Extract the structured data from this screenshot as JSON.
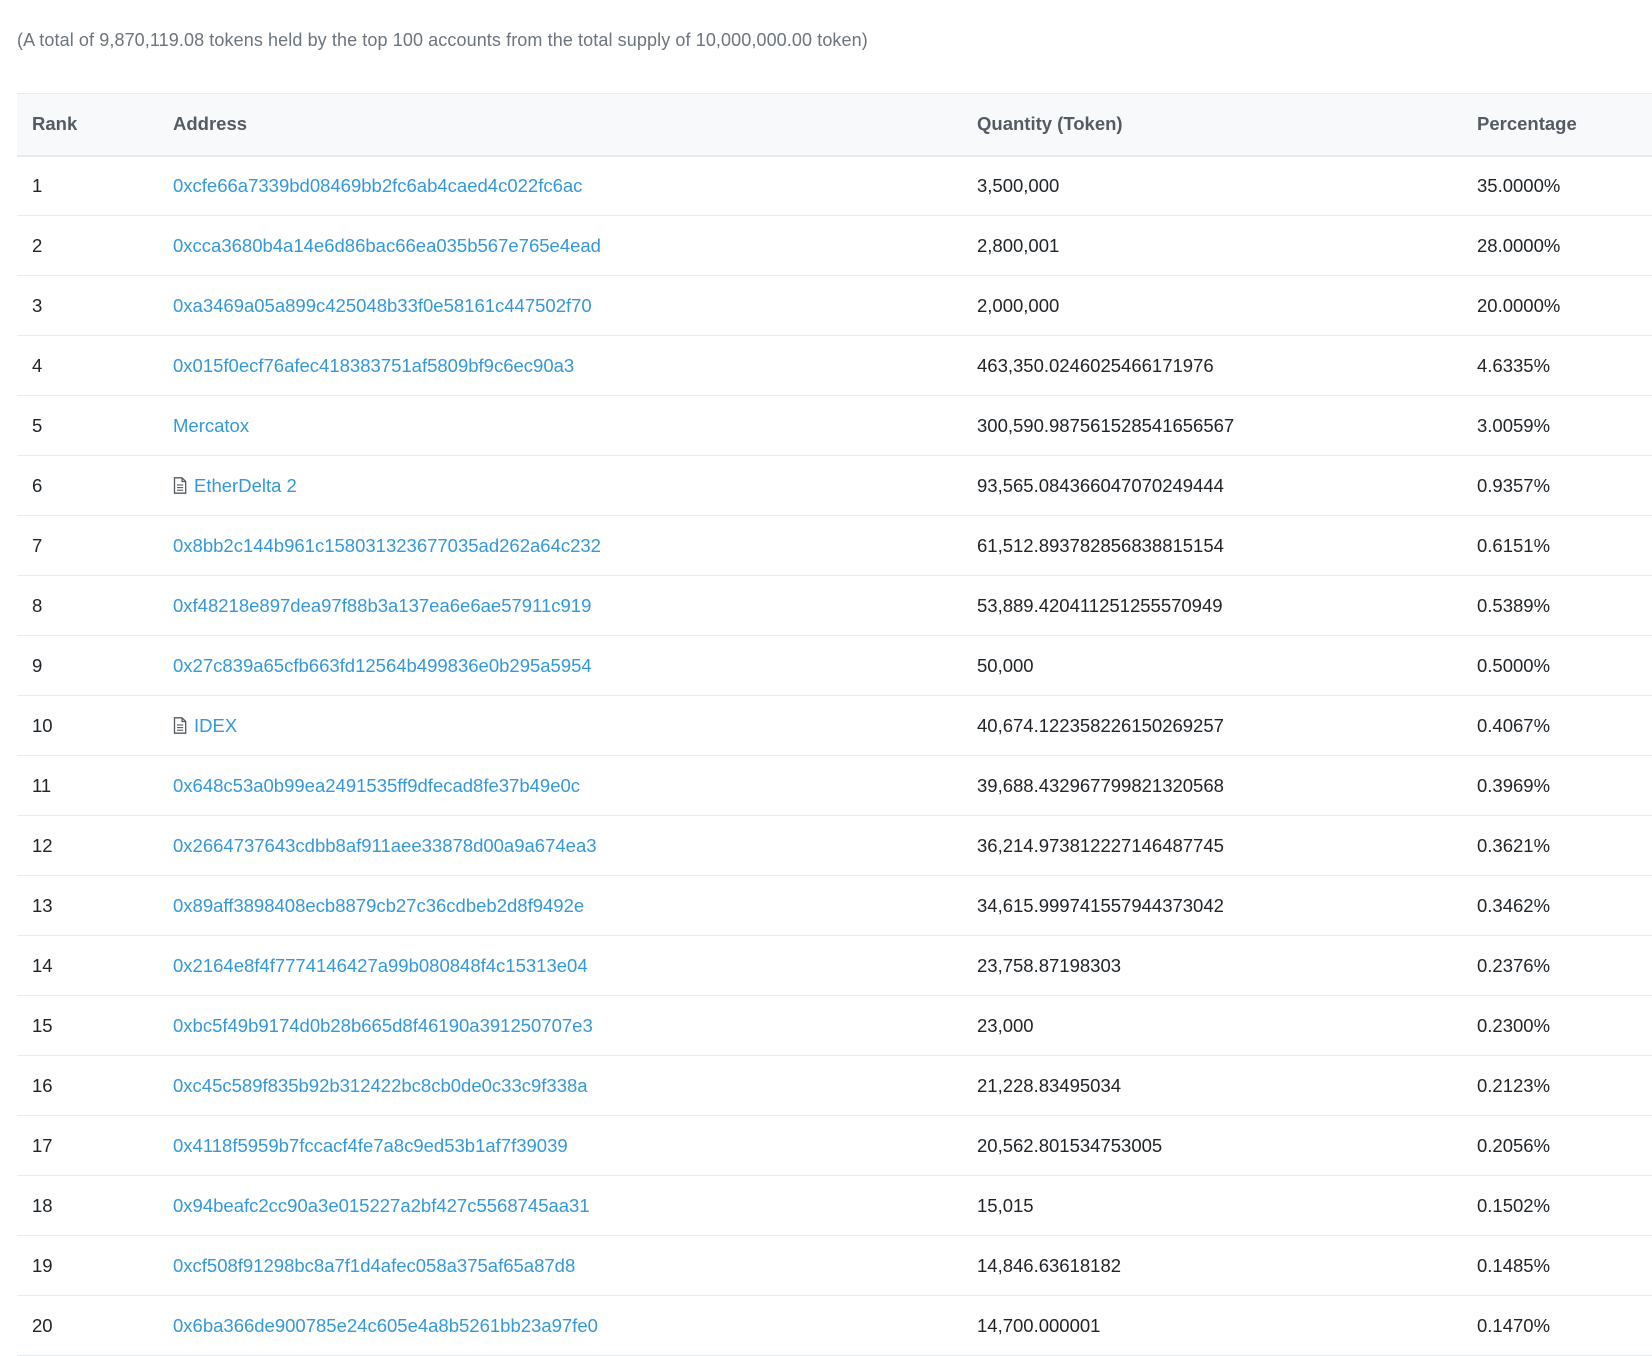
{
  "summary": "(A total of 9,870,119.08 tokens held by the top 100 accounts from the total supply of 10,000,000.00 token)",
  "table": {
    "headers": {
      "rank": "Rank",
      "address": "Address",
      "quantity": "Quantity (Token)",
      "percentage": "Percentage"
    },
    "rows": [
      {
        "rank": "1",
        "address": "0xcfe66a7339bd08469bb2fc6ab4caed4c022fc6ac",
        "contract": false,
        "quantity": "3,500,000",
        "percentage": "35.0000%"
      },
      {
        "rank": "2",
        "address": "0xcca3680b4a14e6d86bac66ea035b567e765e4ead",
        "contract": false,
        "quantity": "2,800,001",
        "percentage": "28.0000%"
      },
      {
        "rank": "3",
        "address": "0xa3469a05a899c425048b33f0e58161c447502f70",
        "contract": false,
        "quantity": "2,000,000",
        "percentage": "20.0000%"
      },
      {
        "rank": "4",
        "address": "0x015f0ecf76afec418383751af5809bf9c6ec90a3",
        "contract": false,
        "quantity": "463,350.0246025466171976",
        "percentage": "4.6335%"
      },
      {
        "rank": "5",
        "address": "Mercatox",
        "contract": false,
        "quantity": "300,590.987561528541656567",
        "percentage": "3.0059%"
      },
      {
        "rank": "6",
        "address": "EtherDelta 2",
        "contract": true,
        "quantity": "93,565.084366047070249444",
        "percentage": "0.9357%"
      },
      {
        "rank": "7",
        "address": "0x8bb2c144b961c158031323677035ad262a64c232",
        "contract": false,
        "quantity": "61,512.893782856838815154",
        "percentage": "0.6151%"
      },
      {
        "rank": "8",
        "address": "0xf48218e897dea97f88b3a137ea6e6ae57911c919",
        "contract": false,
        "quantity": "53,889.420411251255570949",
        "percentage": "0.5389%"
      },
      {
        "rank": "9",
        "address": "0x27c839a65cfb663fd12564b499836e0b295a5954",
        "contract": false,
        "quantity": "50,000",
        "percentage": "0.5000%"
      },
      {
        "rank": "10",
        "address": "IDEX",
        "contract": true,
        "quantity": "40,674.122358226150269257",
        "percentage": "0.4067%"
      },
      {
        "rank": "11",
        "address": "0x648c53a0b99ea2491535ff9dfecad8fe37b49e0c",
        "contract": false,
        "quantity": "39,688.432967799821320568",
        "percentage": "0.3969%"
      },
      {
        "rank": "12",
        "address": "0x2664737643cdbb8af911aee33878d00a9a674ea3",
        "contract": false,
        "quantity": "36,214.973812227146487745",
        "percentage": "0.3621%"
      },
      {
        "rank": "13",
        "address": "0x89aff3898408ecb8879cb27c36cdbeb2d8f9492e",
        "contract": false,
        "quantity": "34,615.999741557944373042",
        "percentage": "0.3462%"
      },
      {
        "rank": "14",
        "address": "0x2164e8f4f7774146427a99b080848f4c15313e04",
        "contract": false,
        "quantity": "23,758.87198303",
        "percentage": "0.2376%"
      },
      {
        "rank": "15",
        "address": "0xbc5f49b9174d0b28b665d8f46190a391250707e3",
        "contract": false,
        "quantity": "23,000",
        "percentage": "0.2300%"
      },
      {
        "rank": "16",
        "address": "0xc45c589f835b92b312422bc8cb0de0c33c9f338a",
        "contract": false,
        "quantity": "21,228.83495034",
        "percentage": "0.2123%"
      },
      {
        "rank": "17",
        "address": "0x4118f5959b7fccacf4fe7a8c9ed53b1af7f39039",
        "contract": false,
        "quantity": "20,562.801534753005",
        "percentage": "0.2056%"
      },
      {
        "rank": "18",
        "address": "0x94beafc2cc90a3e015227a2bf427c5568745aa31",
        "contract": false,
        "quantity": "15,015",
        "percentage": "0.1502%"
      },
      {
        "rank": "19",
        "address": "0xcf508f91298bc8a7f1d4afec058a375af65a87d8",
        "contract": false,
        "quantity": "14,846.63618182",
        "percentage": "0.1485%"
      },
      {
        "rank": "20",
        "address": "0x6ba366de900785e24c605e4a8b5261bb23a97fe0",
        "contract": false,
        "quantity": "14,700.000001",
        "percentage": "0.1470%"
      }
    ]
  },
  "colors": {
    "link": "#3498db",
    "muted": "#6c757d",
    "header_bg": "#f8f9fa",
    "border": "#e7eaf3"
  },
  "icons": {
    "contract": "document-icon"
  }
}
